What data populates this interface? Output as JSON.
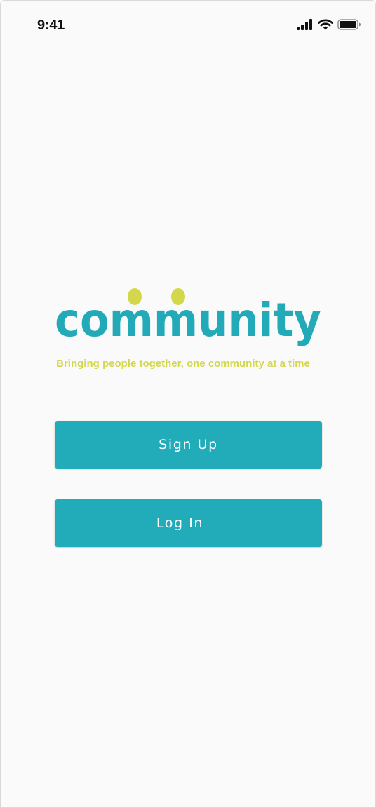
{
  "status_bar": {
    "time": "9:41",
    "icons": [
      "cellular-signal-icon",
      "wifi-icon",
      "battery-icon"
    ]
  },
  "logo": {
    "text": "community",
    "text_color": "#22aab9",
    "head_color": "#d3d84a"
  },
  "tagline": "Bringing people together, one community at a time",
  "actions": {
    "signup_label": "Sign Up",
    "login_label": "Log In"
  },
  "colors": {
    "accent": "#22abb9",
    "secondary": "#d3d84a",
    "background": "#fafafa"
  }
}
